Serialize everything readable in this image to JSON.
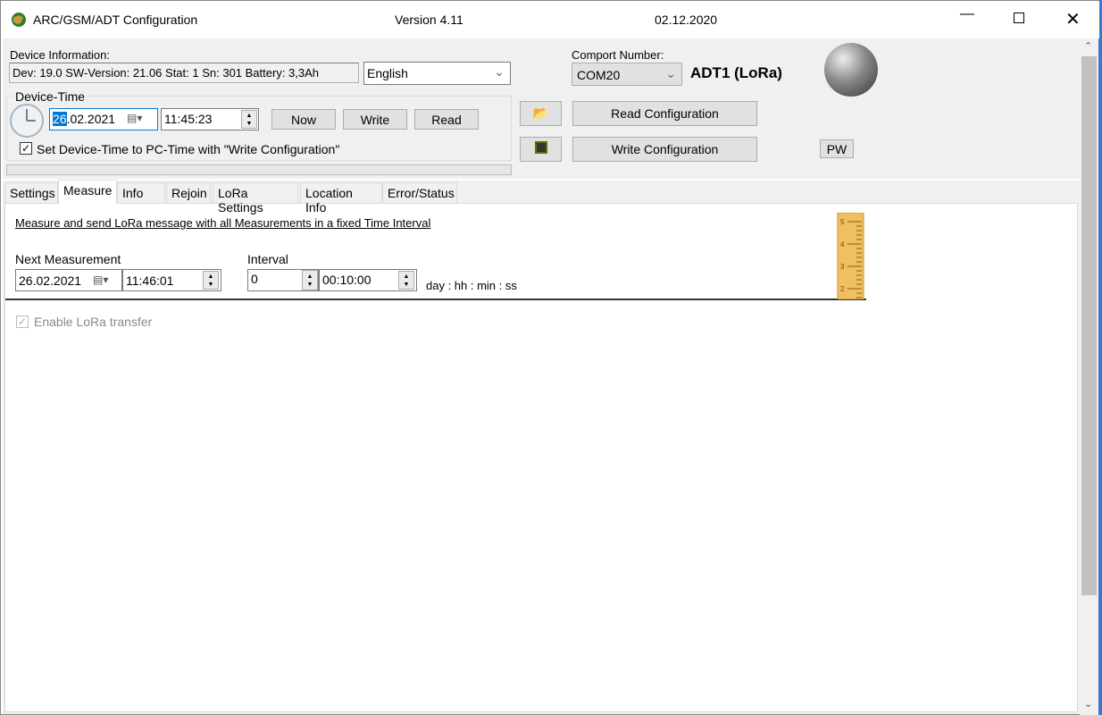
{
  "window": {
    "title": "ARC/GSM/ADT Configuration",
    "version": "Version 4.11",
    "date": "02.12.2020"
  },
  "device_info": {
    "label": "Device Information:",
    "value": "Dev: 19.0 SW-Version: 21.06 Stat: 1 Sn: 301 Battery: 3,3Ah",
    "language": "English"
  },
  "device_time": {
    "label": "Device-Time",
    "date_highlight": "26",
    "date_rest": ".02.2021",
    "time": "11:45:23",
    "now": "Now",
    "write": "Write",
    "read": "Read",
    "sync_label": "Set Device-Time to PC-Time with \"Write Configuration\"",
    "sync_checked": true
  },
  "comport": {
    "label": "Comport Number:",
    "value": "COM20",
    "device": "ADT1 (LoRa)"
  },
  "buttons": {
    "read_config": "Read Configuration",
    "write_config": "Write Configuration",
    "pw": "PW"
  },
  "tabs": [
    {
      "label": "Settings"
    },
    {
      "label": "Measure",
      "active": true
    },
    {
      "label": "Info"
    },
    {
      "label": "Rejoin"
    },
    {
      "label": "LoRa Settings"
    },
    {
      "label": "Location Info"
    },
    {
      "label": "Error/Status"
    }
  ],
  "measure": {
    "heading": "Measure and send LoRa message with all Measurements in a fixed Time Interval",
    "next_label": "Next Measurement",
    "next_date": "26.02.2021",
    "next_time": "11:46:01",
    "interval_label": "Interval",
    "interval_days": "0",
    "interval_time": "00:10:00",
    "interval_unit": "day : hh : min : ss",
    "enable_lora": "Enable LoRa transfer",
    "enable_lora_checked": true,
    "enable_lora_disabled": true
  },
  "ruler_marks": [
    "5",
    "4",
    "3",
    "2"
  ]
}
